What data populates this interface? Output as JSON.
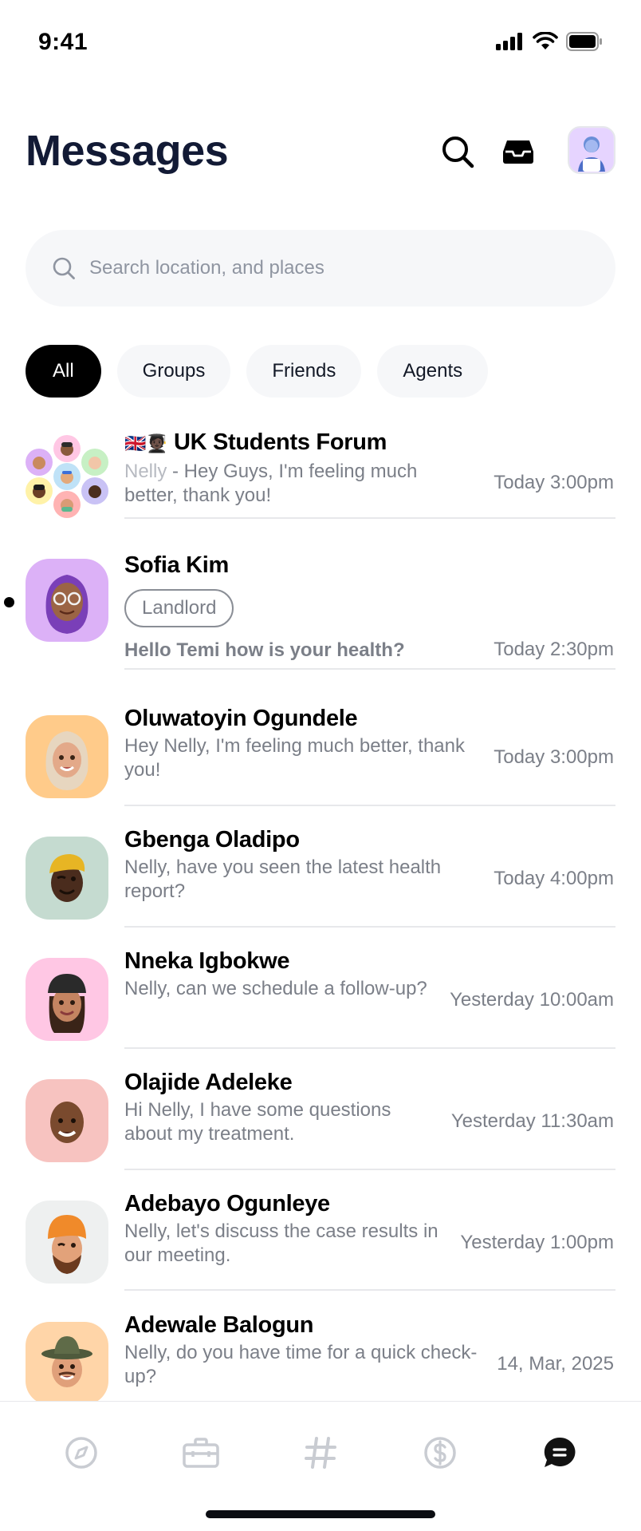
{
  "status_bar": {
    "time": "9:41",
    "icons": [
      "cellular-signal-icon",
      "wifi-icon",
      "battery-icon"
    ]
  },
  "header": {
    "title": "Messages",
    "actions": [
      "search-icon",
      "inbox-icon",
      "profile-avatar"
    ]
  },
  "search": {
    "placeholder": "Search location, and places",
    "value": ""
  },
  "filters": {
    "selected": "All",
    "chips": [
      "All",
      "Groups",
      "Friends",
      "Agents"
    ]
  },
  "conversations": [
    {
      "name": "UK Students Forum",
      "flags": "🇬🇧🧑🏿‍🎓",
      "sender": "Nelly",
      "preview": " - Hey Guys, I'm feeling much better, thank you!",
      "time": "Today 3:00pm",
      "avatar_type": "group"
    },
    {
      "name": "Sofia Kim",
      "tag": "Landlord",
      "preview": "Hello Temi how is your health?",
      "time": "Today 2:30pm",
      "unread": true,
      "avatar_color": "#dcb1f7"
    },
    {
      "name": "Oluwatoyin Ogundele",
      "preview": "Hey Nelly, I'm feeling much better, thank you!",
      "time": "Today 3:00pm",
      "avatar_color": "#ffcb8a"
    },
    {
      "name": "Gbenga Oladipo",
      "preview": "Nelly, have you seen the latest health report?",
      "time": "Today 4:00pm",
      "avatar_color": "#c5dbd0"
    },
    {
      "name": "Nneka Igbokwe",
      "preview": "Nelly, can we schedule a follow-up?",
      "time": "Yesterday 10:00am",
      "avatar_color": "#ffc7e4"
    },
    {
      "name": "Olajide Adeleke",
      "preview": "Hi Nelly, I have some questions about my treatment.",
      "time": "Yesterday 11:30am",
      "avatar_color": "#f7c3c0"
    },
    {
      "name": "Adebayo Ogunleye",
      "preview": "Nelly, let's discuss the case results in our meeting.",
      "time": "Yesterday 1:00pm",
      "avatar_color": "#eef0f0"
    },
    {
      "name": "Adewale Balogun",
      "preview": "Nelly, do you have time for a quick check-up?",
      "time": "14, Mar, 2025",
      "avatar_color": "#ffd5a8"
    }
  ],
  "bottom_nav": {
    "items": [
      "compass-icon",
      "briefcase-icon",
      "hashtag-icon",
      "dollar-icon",
      "chat-icon"
    ],
    "active": "chat-icon"
  },
  "colors": {
    "title": "#121a35",
    "muted": "#7b7f88",
    "chip_active": "#000000",
    "chip_bg": "#f6f7f9"
  }
}
